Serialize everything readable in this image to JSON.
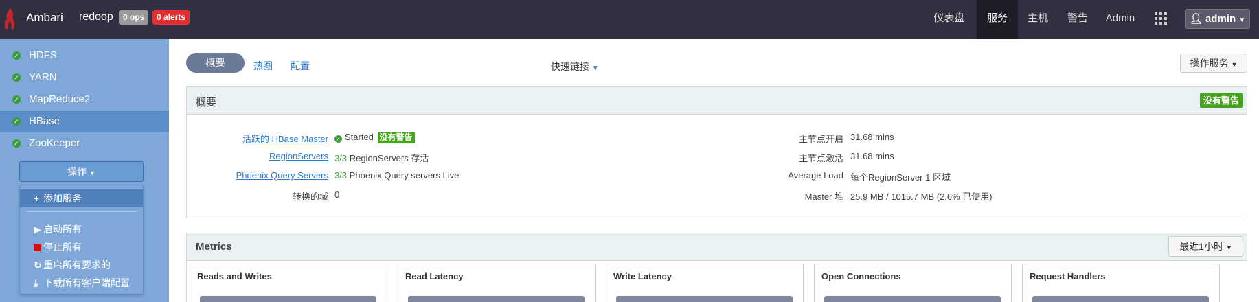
{
  "topbar": {
    "brand": "Ambari",
    "cluster": "redoop",
    "ops_badge": "0 ops",
    "alerts_badge": "0 alerts",
    "nav": [
      {
        "label": "仪表盘"
      },
      {
        "label": "服务"
      },
      {
        "label": "主机"
      },
      {
        "label": "警告"
      },
      {
        "label": "Admin"
      }
    ],
    "user_label": "admin"
  },
  "sidebar": {
    "services": [
      {
        "label": "HDFS"
      },
      {
        "label": "YARN"
      },
      {
        "label": "MapReduce2"
      },
      {
        "label": "HBase"
      },
      {
        "label": "ZooKeeper"
      }
    ],
    "actions_label": "操作",
    "menu": {
      "add_service": "添加服务",
      "start_all": "启动所有",
      "stop_all": "停止所有",
      "restart_required": "重启所有要求的",
      "download_configs": "下载所有客户端配置"
    }
  },
  "main": {
    "tabs": [
      {
        "label": "概要"
      },
      {
        "label": "热图"
      },
      {
        "label": "配置"
      }
    ],
    "quick_links": "快速链接",
    "service_actions": "操作服务",
    "summary": {
      "title": "概要",
      "no_alerts": "没有警告",
      "left": [
        {
          "label": "活跃的 HBase Master",
          "status": "Started",
          "badge": "没有警告"
        },
        {
          "label": "RegionServers",
          "count": "3/3",
          "text": "RegionServers 存活"
        },
        {
          "label": "Phoenix Query Servers",
          "count": "3/3",
          "text": "Phoenix Query servers Live"
        },
        {
          "label": "转换的域",
          "value": "0"
        }
      ],
      "right": [
        {
          "label": "主节点开启",
          "value": "31.68 mins"
        },
        {
          "label": "主节点激活",
          "value": "31.68 mins"
        },
        {
          "label": "Average Load",
          "value": "每个RegionServer 1 区域"
        },
        {
          "label": "Master 堆",
          "value": "25.9 MB / 1015.7 MB (2.6% 已使用)"
        }
      ]
    },
    "metrics": {
      "title": "Metrics",
      "time_range": "最近1小时",
      "widgets": [
        {
          "title": "Reads and Writes"
        },
        {
          "title": "Read Latency"
        },
        {
          "title": "Write Latency"
        },
        {
          "title": "Open Connections"
        },
        {
          "title": "Request Handlers"
        }
      ]
    }
  }
}
